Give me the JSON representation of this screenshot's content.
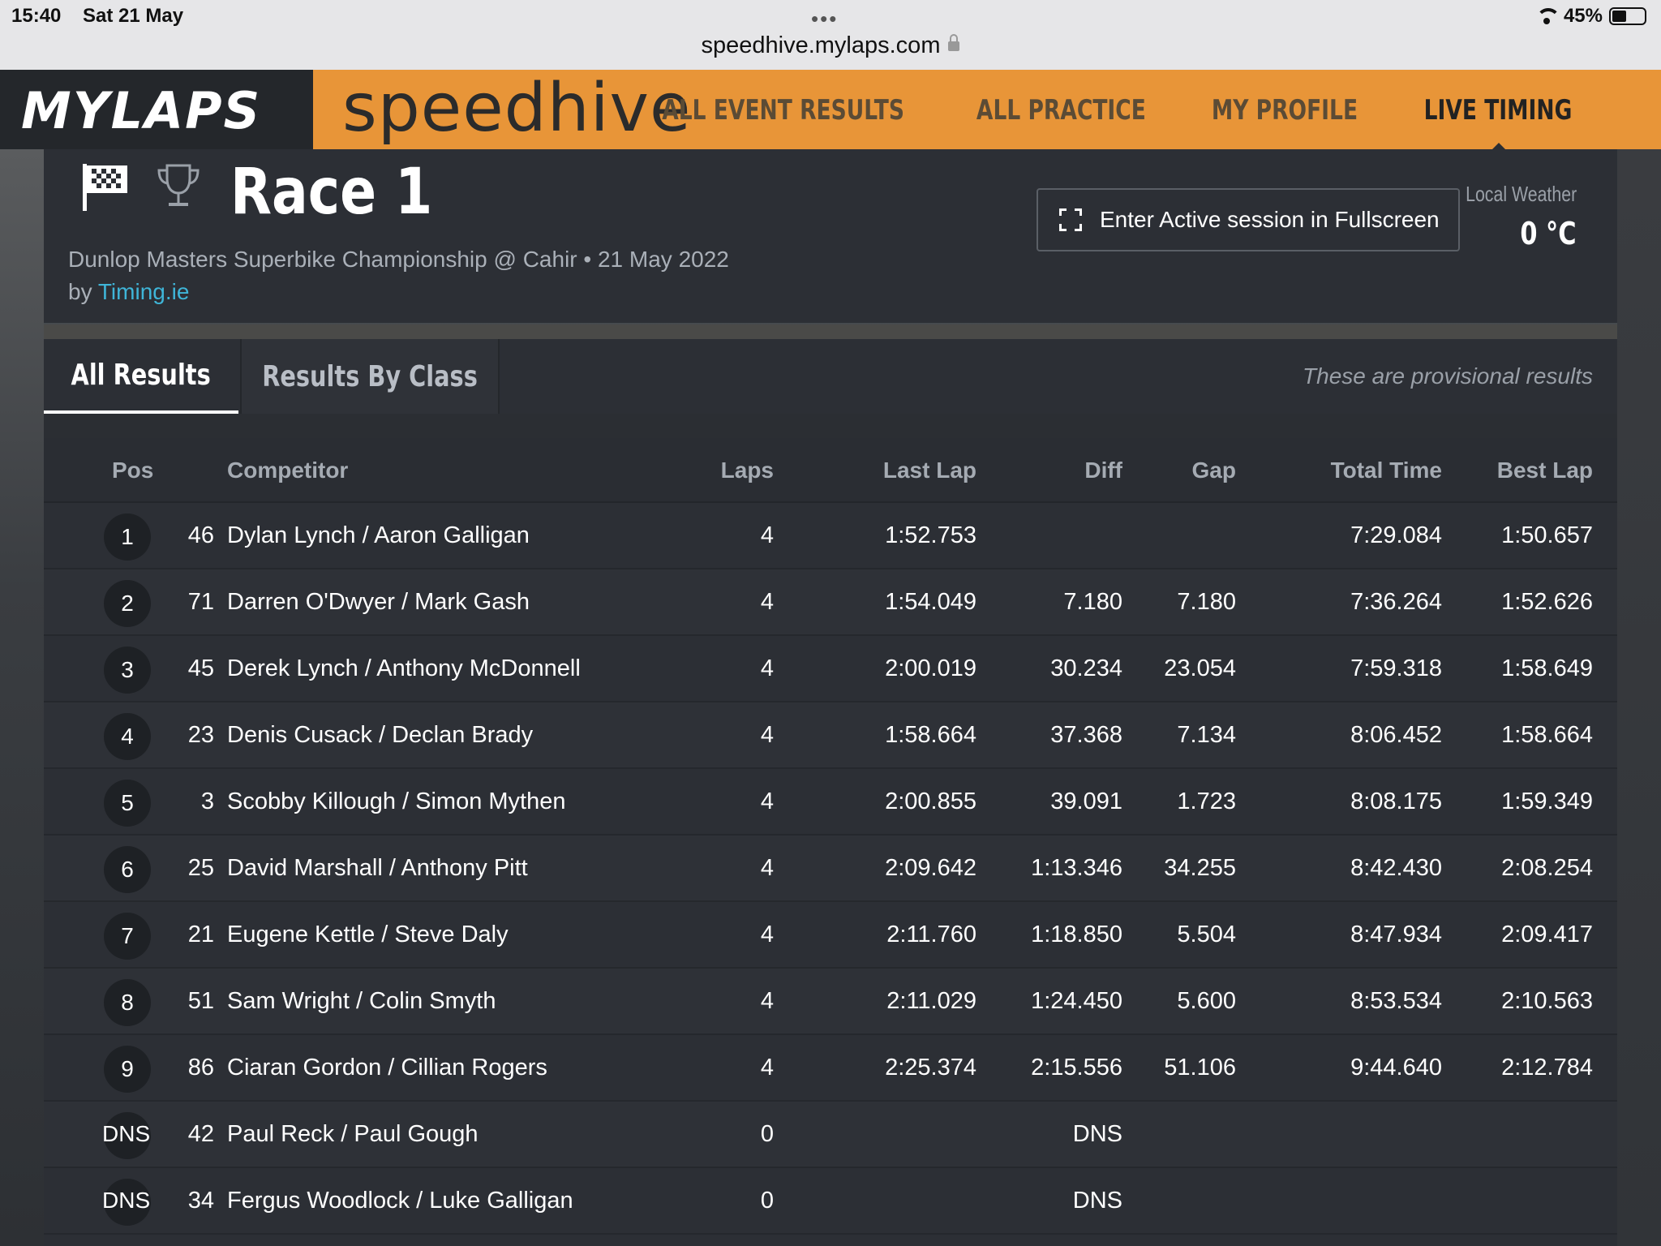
{
  "status_bar": {
    "time": "15:40",
    "date": "Sat 21 May",
    "url": "speedhive.mylaps.com",
    "battery": "45%",
    "battery_level": 0.45
  },
  "header": {
    "brand": "MYLAPS",
    "product": "speedhive",
    "nav": [
      "ALL EVENT RESULTS",
      "ALL PRACTICE",
      "MY PROFILE",
      "LIVE TIMING"
    ],
    "active_nav": "LIVE TIMING",
    "accent_color": "#e89538"
  },
  "event": {
    "title": "Race 1",
    "subtitle": "Dunlop Masters Superbike Championship @ Cahir • 21 May 2022 by",
    "organizer": "Timing.ie",
    "fullscreen_button": "Enter Active session in Fullscreen",
    "weather_label": "Local Weather",
    "weather_temp": "0 °C"
  },
  "tabs": {
    "all_results": "All Results",
    "results_by_class": "Results By Class",
    "provisional_note": "These are provisional results"
  },
  "table": {
    "columns": {
      "pos": "Pos",
      "competitor": "Competitor",
      "laps": "Laps",
      "last_lap": "Last Lap",
      "diff": "Diff",
      "gap": "Gap",
      "total_time": "Total Time",
      "best_lap": "Best Lap"
    },
    "rows": [
      {
        "pos": "1",
        "num": "46",
        "name": "Dylan Lynch / Aaron Galligan",
        "laps": "4",
        "last": "1:52.753",
        "diff": "",
        "gap": "",
        "total": "7:29.084",
        "best": "1:50.657"
      },
      {
        "pos": "2",
        "num": "71",
        "name": "Darren O'Dwyer / Mark Gash",
        "laps": "4",
        "last": "1:54.049",
        "diff": "7.180",
        "gap": "7.180",
        "total": "7:36.264",
        "best": "1:52.626"
      },
      {
        "pos": "3",
        "num": "45",
        "name": "Derek Lynch / Anthony McDonnell",
        "laps": "4",
        "last": "2:00.019",
        "diff": "30.234",
        "gap": "23.054",
        "total": "7:59.318",
        "best": "1:58.649"
      },
      {
        "pos": "4",
        "num": "23",
        "name": "Denis Cusack / Declan Brady",
        "laps": "4",
        "last": "1:58.664",
        "diff": "37.368",
        "gap": "7.134",
        "total": "8:06.452",
        "best": "1:58.664"
      },
      {
        "pos": "5",
        "num": "3",
        "name": "Scobby Killough / Simon Mythen",
        "laps": "4",
        "last": "2:00.855",
        "diff": "39.091",
        "gap": "1.723",
        "total": "8:08.175",
        "best": "1:59.349"
      },
      {
        "pos": "6",
        "num": "25",
        "name": "David Marshall / Anthony Pitt",
        "laps": "4",
        "last": "2:09.642",
        "diff": "1:13.346",
        "gap": "34.255",
        "total": "8:42.430",
        "best": "2:08.254"
      },
      {
        "pos": "7",
        "num": "21",
        "name": "Eugene Kettle / Steve Daly",
        "laps": "4",
        "last": "2:11.760",
        "diff": "1:18.850",
        "gap": "5.504",
        "total": "8:47.934",
        "best": "2:09.417"
      },
      {
        "pos": "8",
        "num": "51",
        "name": "Sam Wright / Colin Smyth",
        "laps": "4",
        "last": "2:11.029",
        "diff": "1:24.450",
        "gap": "5.600",
        "total": "8:53.534",
        "best": "2:10.563"
      },
      {
        "pos": "9",
        "num": "86",
        "name": "Ciaran Gordon / Cillian Rogers",
        "laps": "4",
        "last": "2:25.374",
        "diff": "2:15.556",
        "gap": "51.106",
        "total": "9:44.640",
        "best": "2:12.784"
      },
      {
        "pos": "DNS",
        "num": "42",
        "name": "Paul Reck / Paul Gough",
        "laps": "0",
        "last": "",
        "diff": "DNS",
        "gap": "",
        "total": "",
        "best": ""
      },
      {
        "pos": "DNS",
        "num": "34",
        "name": "Fergus Woodlock / Luke Galligan",
        "laps": "0",
        "last": "",
        "diff": "DNS",
        "gap": "",
        "total": "",
        "best": ""
      }
    ]
  }
}
